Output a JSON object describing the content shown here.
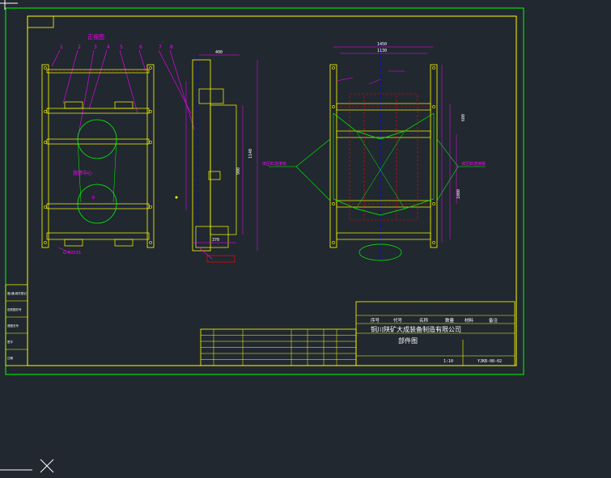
{
  "colors": {
    "background": "#212830",
    "frame": "#00ff00",
    "inner_frame": "#ffff00",
    "part": "#ffff00",
    "dimension": "#ff00ff",
    "centerline": "#0000ff",
    "hidden_line": "#ff0000",
    "leader": "#ff00ff",
    "text_white": "#ffffff",
    "crosshair": "#ffffff"
  },
  "drawing": {
    "view_title": "正视图",
    "balloons": [
      "1",
      "2",
      "3",
      "4",
      "5",
      "6",
      "7",
      "8"
    ],
    "center_label": "旋转中心",
    "company": "铜川陕矿大成装备制造有限公司",
    "sheet_title": "部件图",
    "left_leader_note": "G-40X3S",
    "drawing_number": "YJKB-08-02",
    "scale": "1:10",
    "tb_headers": [
      "序号",
      "代号",
      "名称",
      "数量",
      "材料",
      "备注"
    ],
    "side_tabs": [
      "借(通)用件登记",
      "旧底图总号",
      "底图总号",
      "签字",
      "日期"
    ],
    "dims": {
      "d_top_width": "1450",
      "d_inner_width": "1130",
      "d_side_top": "400",
      "d_side_height": "1140",
      "d_side_h2": "900",
      "d_bottom": "370",
      "d_r_height": "1000",
      "d_r_h2": "600"
    }
  }
}
